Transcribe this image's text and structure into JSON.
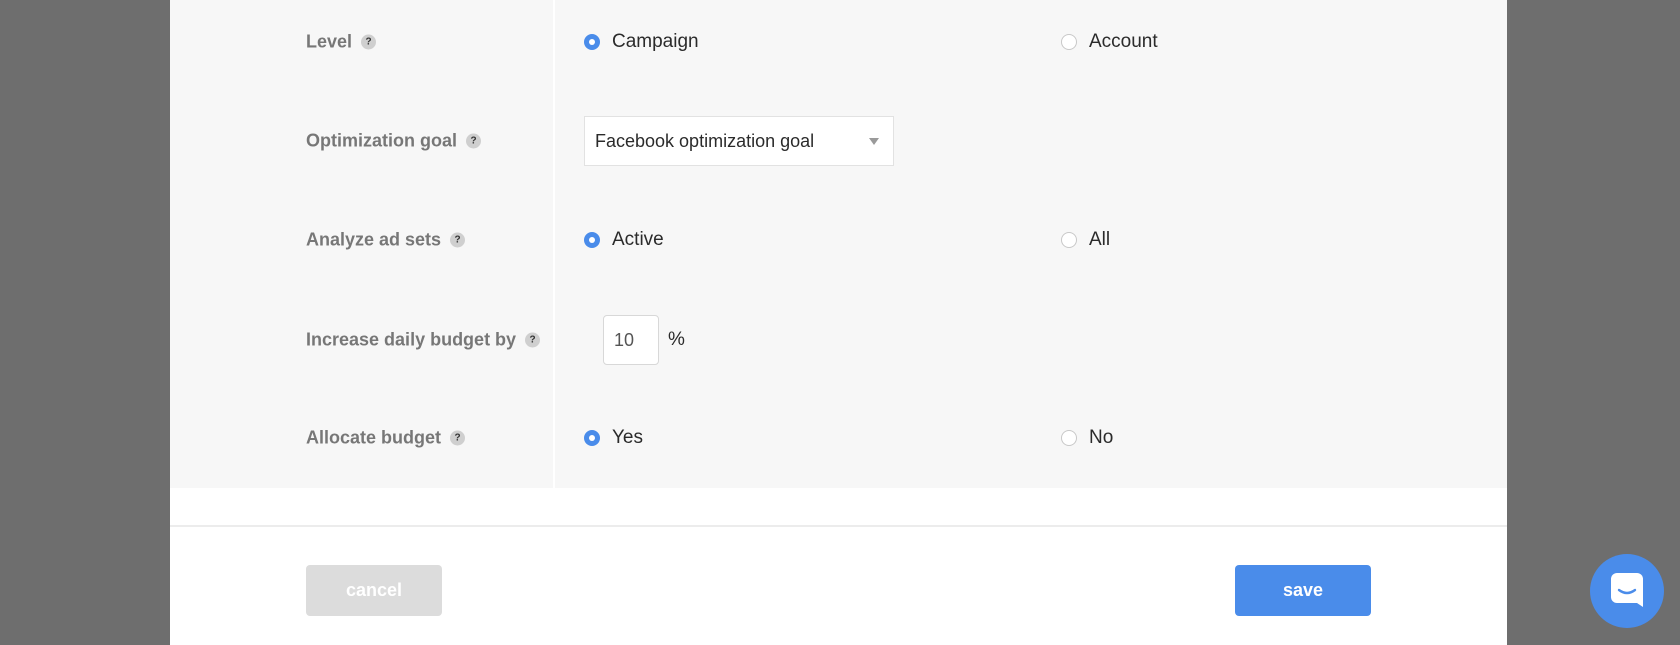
{
  "form": {
    "level": {
      "label": "Level",
      "help": "?",
      "options": [
        "Campaign",
        "Account"
      ],
      "selected": "Campaign"
    },
    "optimization_goal": {
      "label": "Optimization goal",
      "help": "?",
      "value": "Facebook optimization goal"
    },
    "analyze_ad_sets": {
      "label": "Analyze ad sets",
      "help": "?",
      "options": [
        "Active",
        "All"
      ],
      "selected": "Active"
    },
    "increase_budget": {
      "label": "Increase daily budget by",
      "help": "?",
      "value": "10",
      "unit": "%"
    },
    "allocate_budget": {
      "label": "Allocate budget",
      "help": "?",
      "options": [
        "Yes",
        "No"
      ],
      "selected": "Yes"
    }
  },
  "footer": {
    "cancel_label": "cancel",
    "save_label": "save"
  },
  "chat": {
    "icon": "chat-bubble-icon"
  },
  "colors": {
    "accent": "#4a8cea",
    "overlay": "#6e6e6e",
    "panel": "#f7f7f7",
    "label_text": "#777777",
    "disabled_button": "#dcdcdc"
  }
}
